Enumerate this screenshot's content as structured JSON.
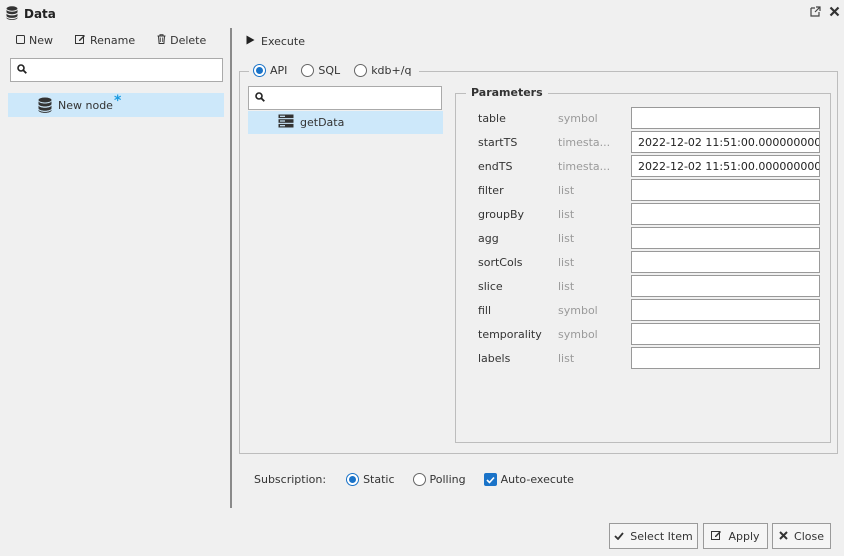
{
  "window": {
    "title": "Data"
  },
  "left": {
    "toolbar": {
      "new_label": "New",
      "rename_label": "Rename",
      "delete_label": "Delete"
    },
    "search": {
      "value": "",
      "placeholder": ""
    },
    "tree": [
      {
        "label": "New node",
        "modified_marker": "*"
      }
    ]
  },
  "right": {
    "execute_label": "Execute",
    "modes": {
      "api_label": "API",
      "sql_label": "SQL",
      "kdb_label": "kdb+/q",
      "selected": "API"
    },
    "func_search": {
      "value": "",
      "placeholder": ""
    },
    "functions": [
      {
        "label": "getData"
      }
    ],
    "parameters": {
      "title": "Parameters",
      "rows": [
        {
          "name": "table",
          "type": "symbol",
          "value": ""
        },
        {
          "name": "startTS",
          "type": "timesta...",
          "value": "2022-12-02 11:51:00.000000000"
        },
        {
          "name": "endTS",
          "type": "timesta...",
          "value": "2022-12-02 11:51:00.000000000"
        },
        {
          "name": "filter",
          "type": "list",
          "value": ""
        },
        {
          "name": "groupBy",
          "type": "list",
          "value": ""
        },
        {
          "name": "agg",
          "type": "list",
          "value": ""
        },
        {
          "name": "sortCols",
          "type": "list",
          "value": ""
        },
        {
          "name": "slice",
          "type": "list",
          "value": ""
        },
        {
          "name": "fill",
          "type": "symbol",
          "value": ""
        },
        {
          "name": "temporality",
          "type": "symbol",
          "value": ""
        },
        {
          "name": "labels",
          "type": "list",
          "value": ""
        }
      ]
    },
    "subscription": {
      "label": "Subscription:",
      "static_label": "Static",
      "polling_label": "Polling",
      "selected": "Static",
      "auto_execute_label": "Auto-execute",
      "auto_execute": true
    }
  },
  "footer": {
    "select_item_label": "Select Item",
    "apply_label": "Apply",
    "close_label": "Close"
  },
  "colors": {
    "accent": "#1a73c8",
    "selection": "#cde8fa",
    "modified": "#1a9ae0",
    "background": "#f0f0f0"
  }
}
